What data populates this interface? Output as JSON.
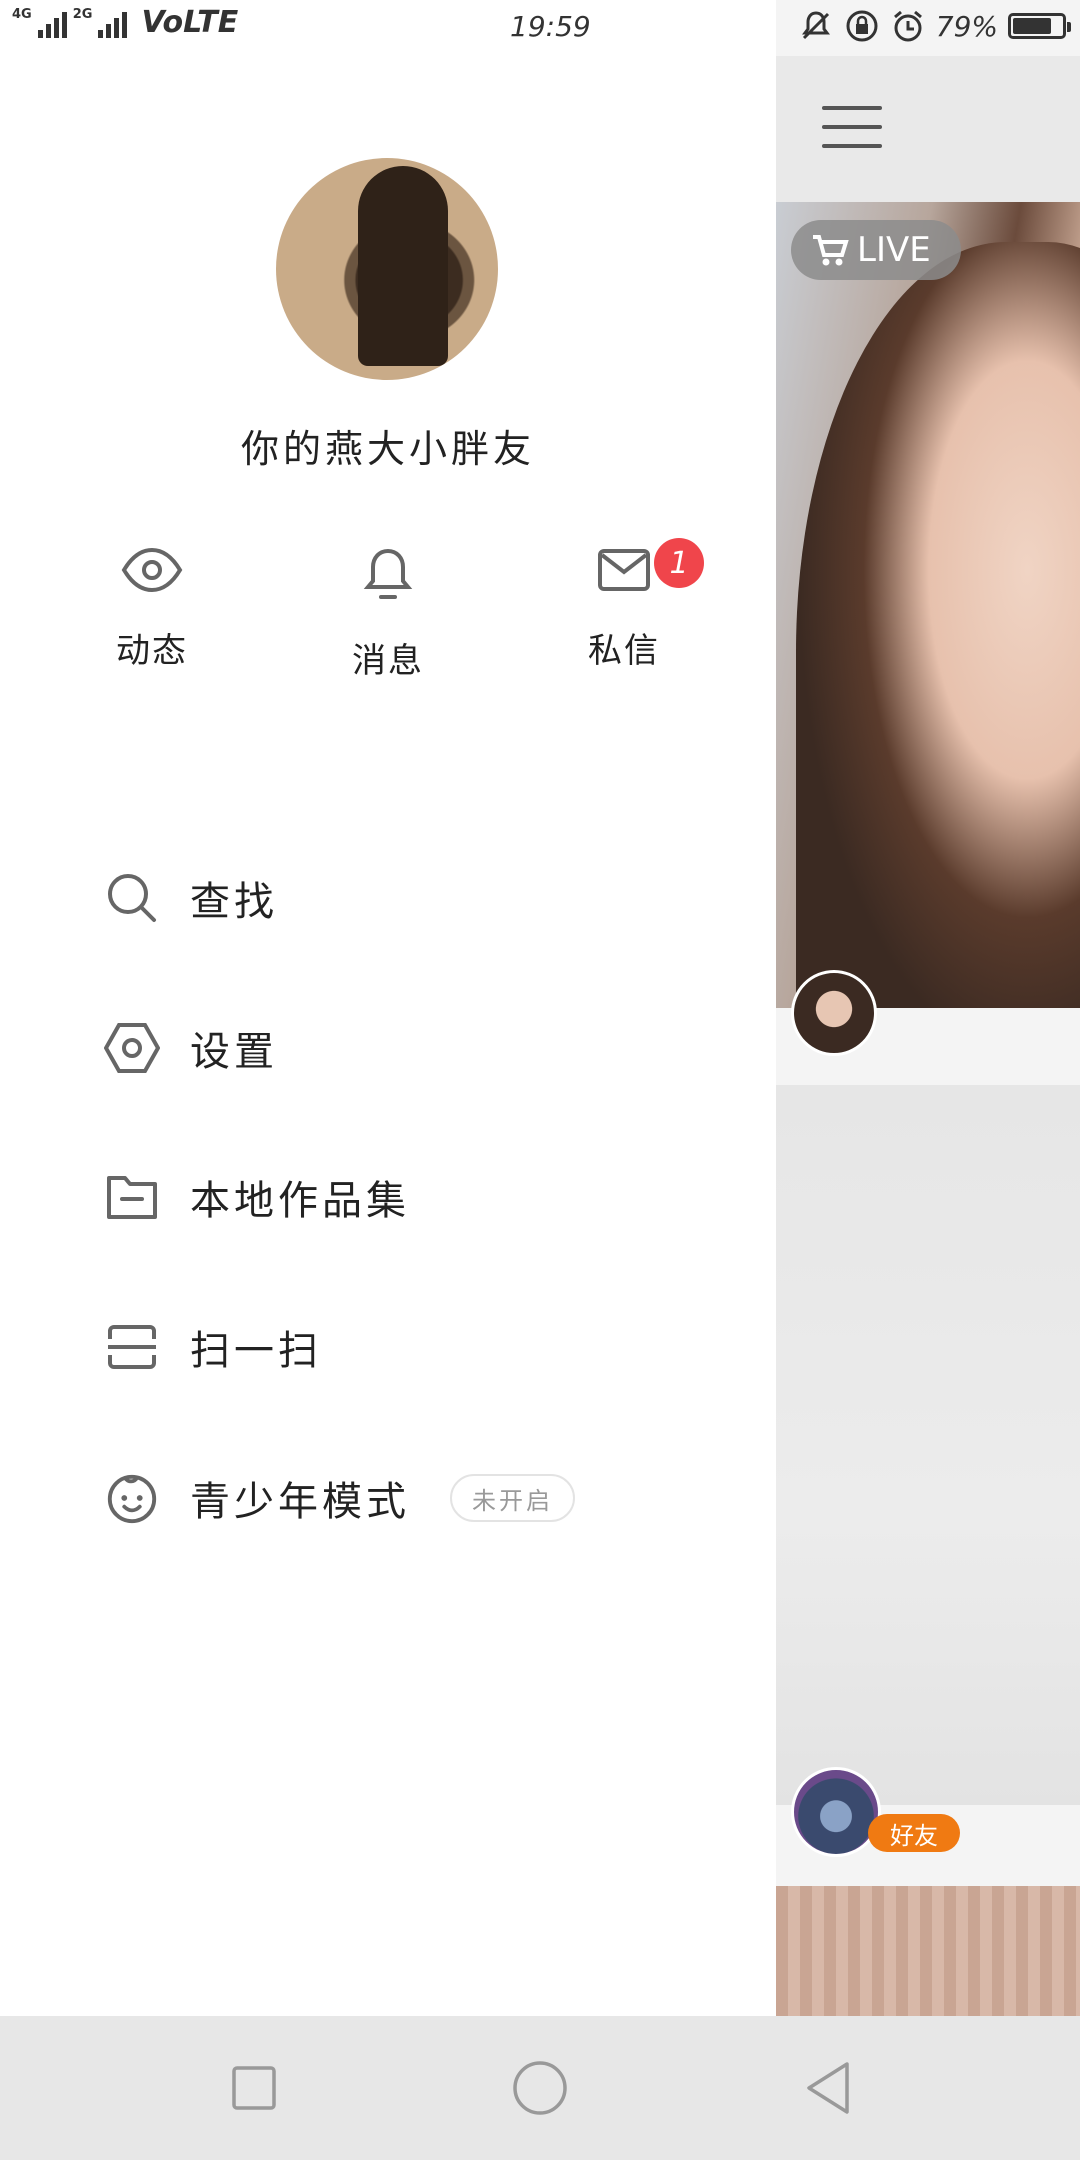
{
  "status_bar": {
    "network_label_1": "4G",
    "network_label_2": "2G",
    "volte": "VoLTE",
    "time": "19:59",
    "battery_percent_text": "79%",
    "battery_level": 0.79,
    "icons": [
      "mute-icon",
      "lock-rotation-icon",
      "alarm-icon",
      "battery-icon"
    ]
  },
  "drawer": {
    "username": "你的燕大小胖友",
    "quick_actions": [
      {
        "label": "动态",
        "icon": "eye-icon"
      },
      {
        "label": "消息",
        "icon": "bell-icon"
      },
      {
        "label": "私信",
        "icon": "mail-icon",
        "badge": "1"
      }
    ],
    "menu": [
      {
        "label": "查找",
        "icon": "search-icon"
      },
      {
        "label": "设置",
        "icon": "settings-hexagon-icon"
      },
      {
        "label": "本地作品集",
        "icon": "folder-icon"
      },
      {
        "label": "扫一扫",
        "icon": "scan-icon"
      },
      {
        "label": "青少年模式",
        "icon": "child-face-icon",
        "pill": "未开启"
      }
    ]
  },
  "feed": {
    "live_badge": "LIVE",
    "friend_tag": "好友"
  },
  "nav_bar": {
    "buttons": [
      "recent-apps-button",
      "home-button",
      "back-button"
    ]
  },
  "colors": {
    "badge": "#f0454b",
    "friend_tag": "#f07a12",
    "icon_stroke": "#666666",
    "nav_bg": "#e7e7e7"
  }
}
